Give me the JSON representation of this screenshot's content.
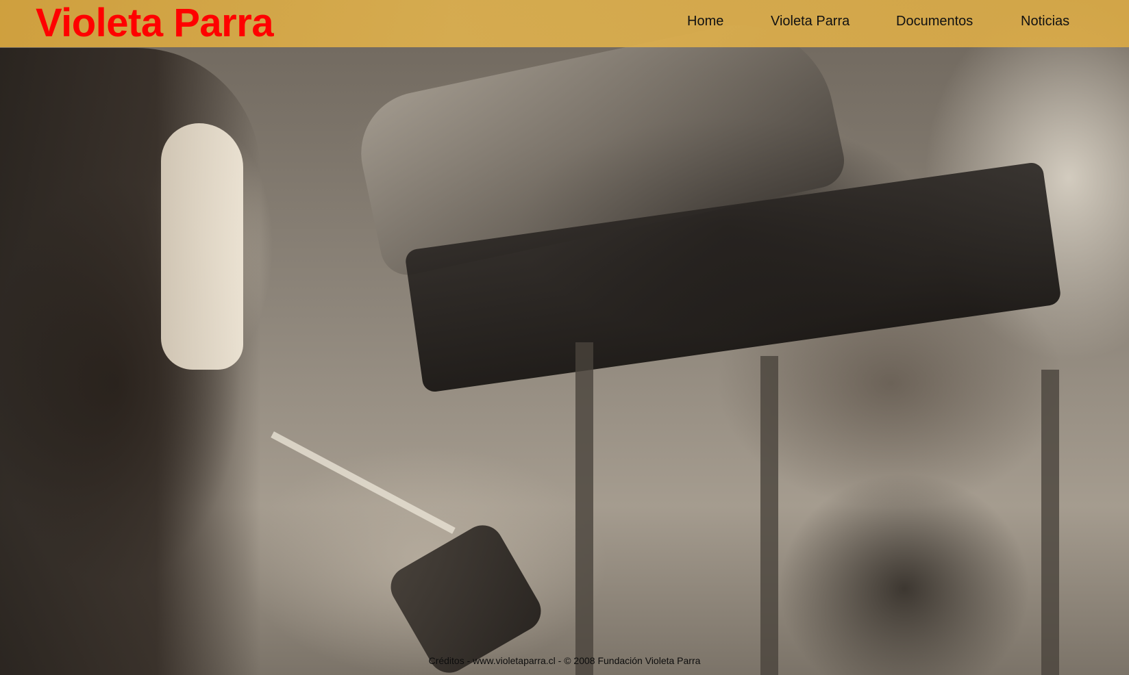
{
  "header": {
    "site_title": "Violeta Parra",
    "nav": [
      {
        "label": "Home"
      },
      {
        "label": "Violeta Parra"
      },
      {
        "label": "Documentos"
      },
      {
        "label": "Noticias"
      }
    ]
  },
  "hero": {
    "image_icon": "hero-photo"
  },
  "footer": {
    "credits_link": "Créditos",
    "separator1": " - ",
    "site_link": "www.violetaparra.cl",
    "copyright": " - © 2008 Fundación Violeta Parra"
  },
  "colors": {
    "title": "#ff0000",
    "header_bar": "#d9a84a",
    "nav_text": "#111111"
  }
}
